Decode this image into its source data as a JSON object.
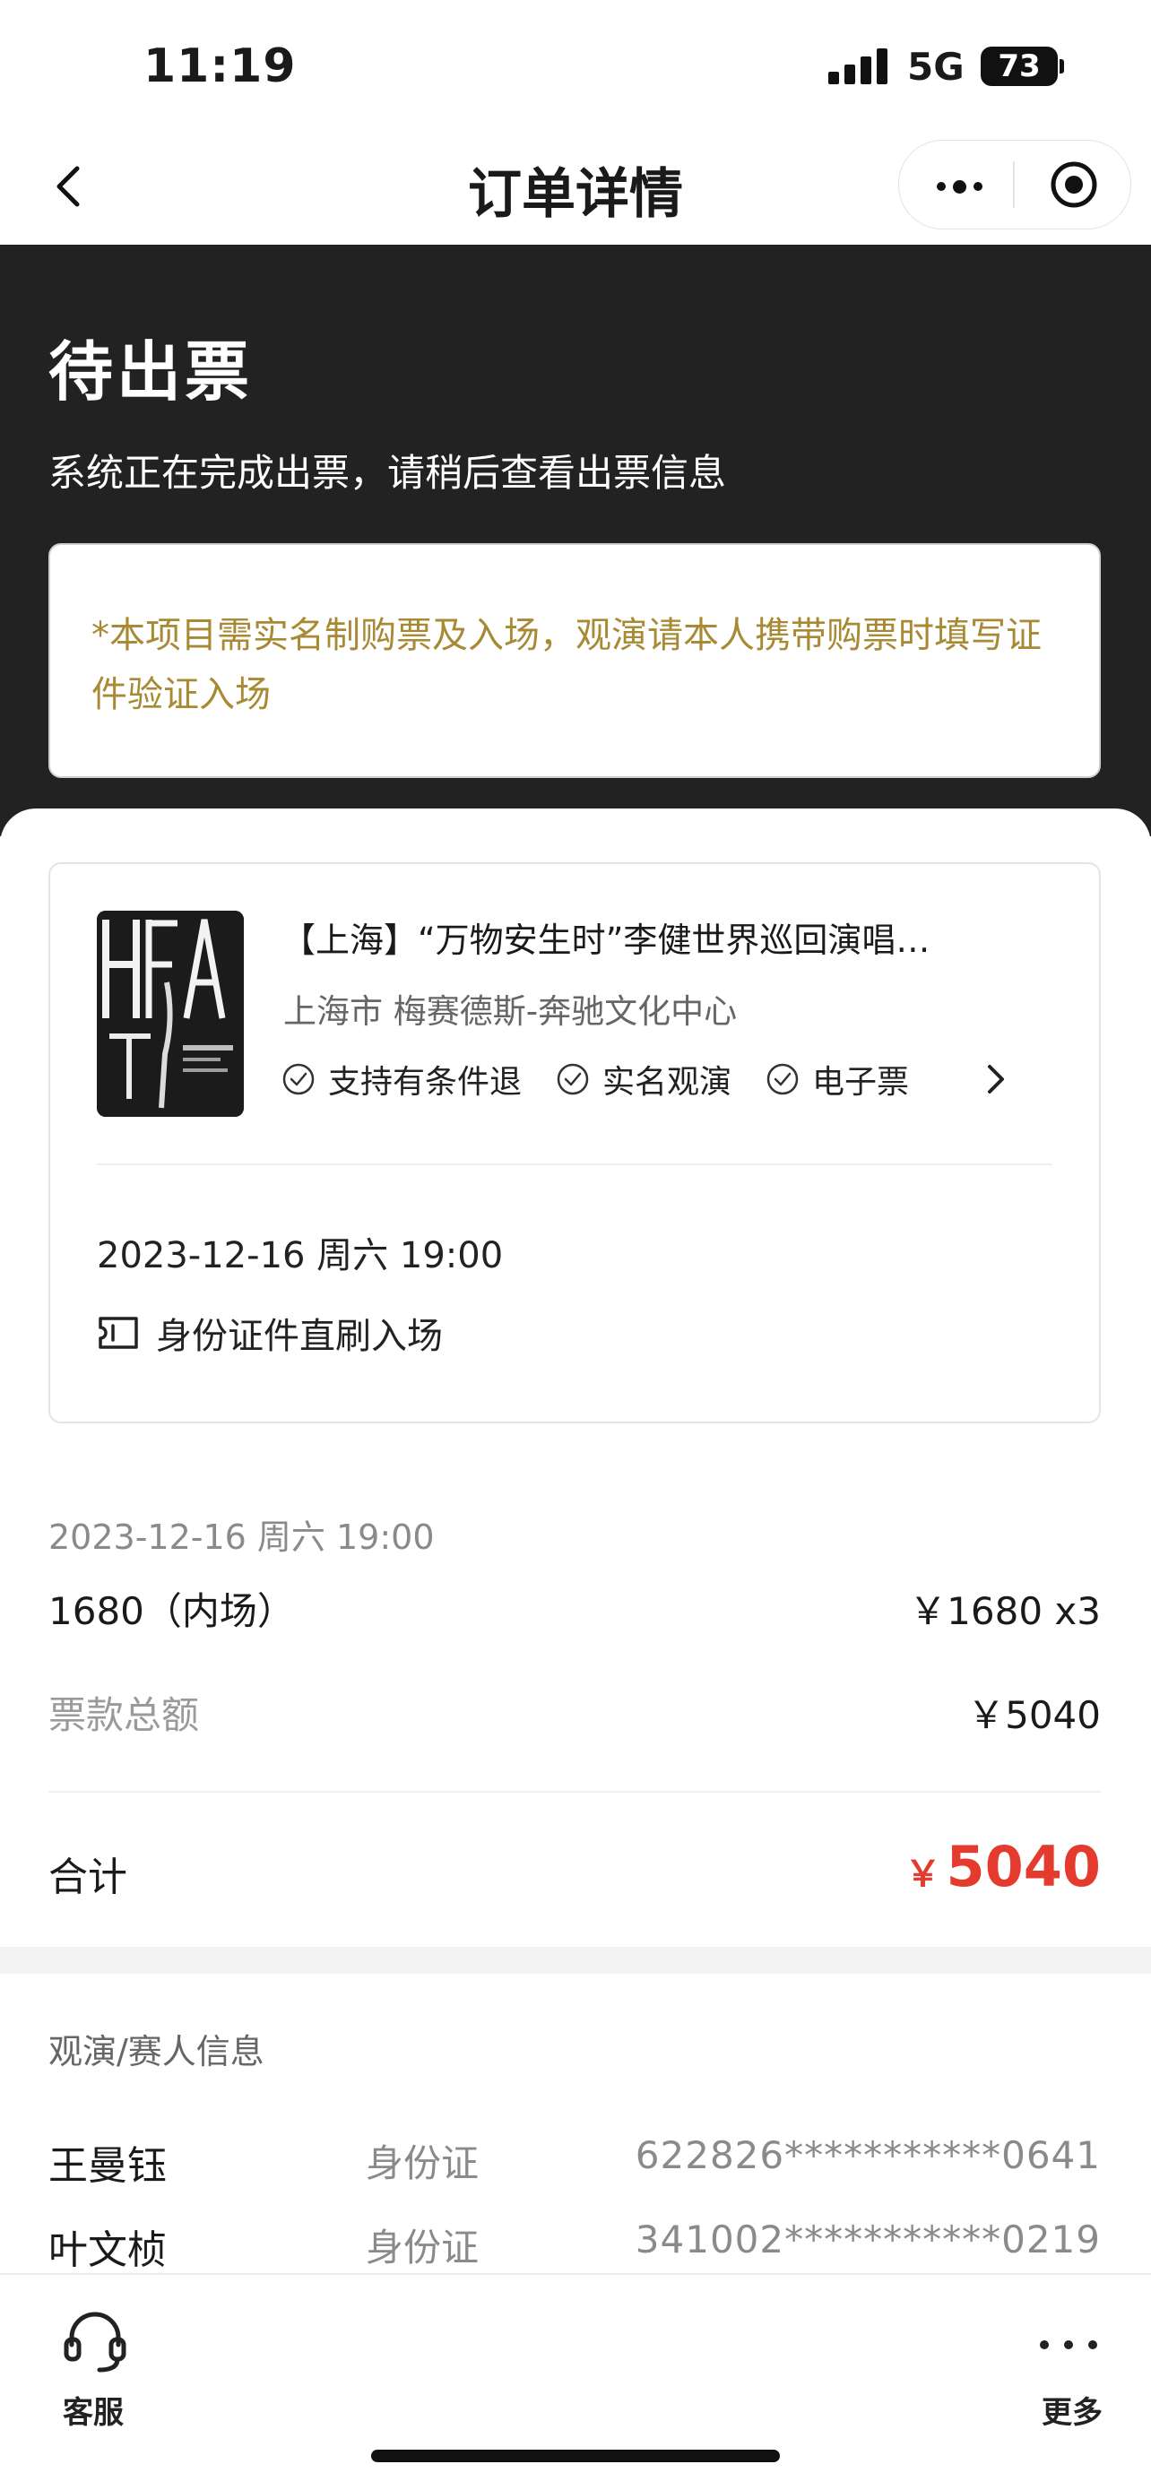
{
  "status_bar": {
    "time": "11:19",
    "network": "5G",
    "battery": "73"
  },
  "nav": {
    "title": "订单详情"
  },
  "header": {
    "status": "待出票",
    "subtitle": "系统正在完成出票，请稍后查看出票信息",
    "notice": "*本项目需实名制购票及入场，观演请本人携带购票时填写证件验证入场"
  },
  "event": {
    "title": "【上海】“万物安生时”李健世界巡回演唱…",
    "venue": "上海市 梅赛德斯-奔驰文化中心",
    "tags": [
      "支持有条件退",
      "实名观演",
      "电子票"
    ],
    "datetime": "2023-12-16 周六 19:00",
    "entry": "身份证件直刷入场"
  },
  "pricing": {
    "datetime": "2023-12-16 周六 19:00",
    "tier": "1680（内场）",
    "tier_price": "￥1680 x3",
    "total_label": "票款总额",
    "total_value": "￥5040",
    "sum_label": "合计",
    "sum_currency": "￥",
    "sum_value": "5040"
  },
  "audience": {
    "heading": "观演/赛人信息",
    "people": [
      {
        "name": "王曼钰",
        "id_type": "身份证",
        "id_number": "622826***********0641"
      },
      {
        "name": "叶文桢",
        "id_type": "身份证",
        "id_number": "341002***********0219"
      }
    ]
  },
  "bottom": {
    "service_label": "客服",
    "more_label": "更多"
  },
  "colors": {
    "header_bg": "#222222",
    "notice_text": "#a88a34",
    "price_red": "#e53a2e"
  },
  "icons": [
    "back-icon",
    "more-dots-icon",
    "target-icon",
    "check-circle-icon",
    "chevron-right-icon",
    "id-card-icon",
    "headset-icon",
    "more-icon"
  ]
}
